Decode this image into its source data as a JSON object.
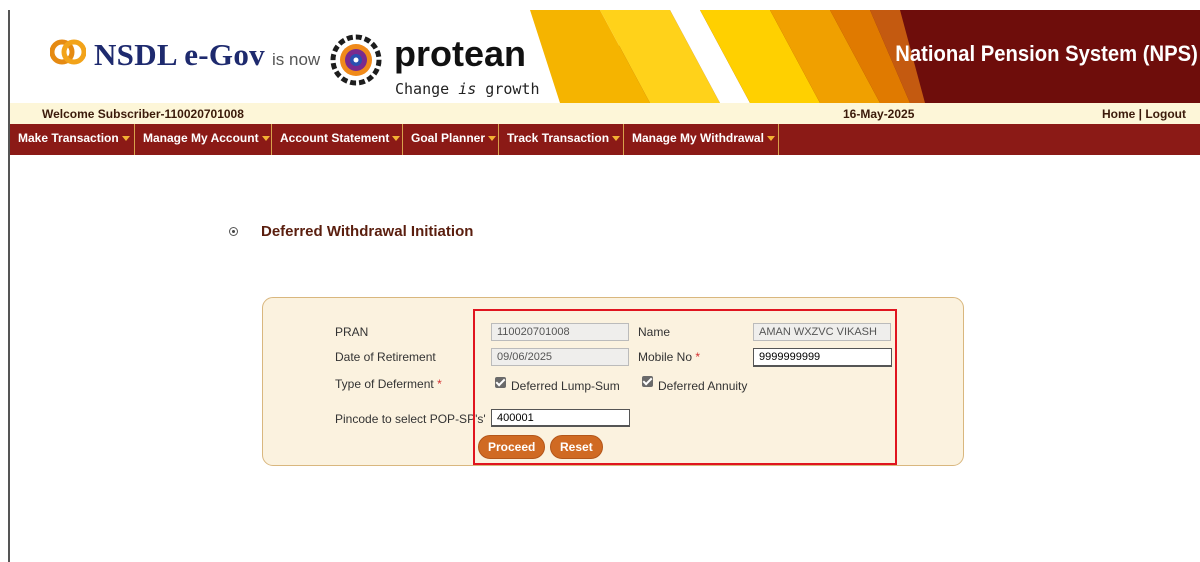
{
  "header": {
    "nsdl_text": "NSDL e-Gov",
    "is_now": "is now",
    "protean_word": "protean",
    "protean_tag_pre": "Change ",
    "protean_tag_em": "is",
    "protean_tag_post": " growth",
    "system_title": "National Pension System (NPS)"
  },
  "welcome": {
    "subscriber": "Welcome Subscriber-110020701008",
    "date": "16-May-2025",
    "home": "Home",
    "separator": " | ",
    "logout": "Logout"
  },
  "nav": {
    "items": [
      "Make Transaction",
      "Manage My Account",
      "Account Statement",
      "Goal Planner",
      "Track Transaction",
      "Manage My Withdrawal"
    ]
  },
  "page": {
    "title": "Deferred Withdrawal Initiation"
  },
  "form": {
    "pran_label": "PRAN",
    "pran_value": "110020701008",
    "name_label": "Name",
    "name_value": "AMAN WXZVC VIKASH",
    "dor_label": "Date of Retirement",
    "dor_value": "09/06/2025",
    "mobile_label": "Mobile No",
    "mobile_value": "9999999999",
    "deferment_label": "Type of Deferment",
    "required_mark": "*",
    "opt_lumpsum": "Deferred Lump-Sum",
    "opt_annuity": "Deferred Annuity",
    "pincode_label": "Pincode to select POP-SP's'",
    "pincode_value": "400001",
    "proceed": "Proceed",
    "reset": "Reset"
  },
  "colors": {
    "header_bg": "#6e0d0b",
    "nav_bg": "#8b1a16",
    "accent_orange": "#d06a23",
    "highlight_red": "#e0151f"
  }
}
